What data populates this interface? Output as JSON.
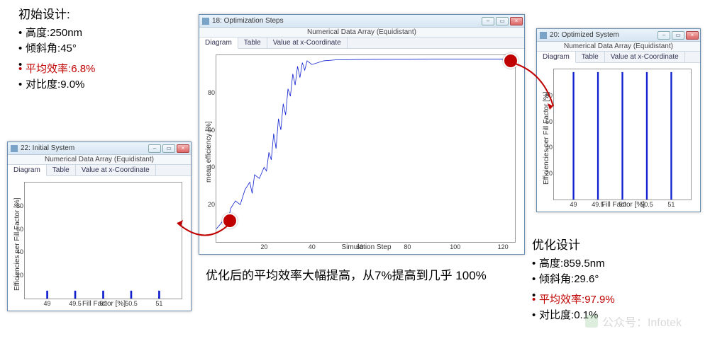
{
  "initial": {
    "heading": "初始设计:",
    "lines": [
      {
        "label": "高度",
        "value": "250nm"
      },
      {
        "label": "倾斜角",
        "value": "45°"
      },
      {
        "label": "平均效率",
        "value": "6.8%",
        "red": true
      },
      {
        "label": "对比度",
        "value": "9.0%"
      }
    ]
  },
  "optimized": {
    "heading": "优化设计",
    "lines": [
      {
        "label": "高度",
        "value": "859.5nm"
      },
      {
        "label": "倾斜角",
        "value": "29.6°"
      },
      {
        "label": "平均效率",
        "value": "97.9%",
        "red": true
      },
      {
        "label": "对比度",
        "value": "0.1%"
      }
    ]
  },
  "caption": "优化后的平均效率大幅提高，从7%提高到几乎 100%",
  "watermark": "公众号：Infotek",
  "windows": {
    "left": {
      "title": "22: Initial System",
      "subtitle": "Numerical Data Array (Equidistant)",
      "tabs": [
        "Diagram",
        "Table",
        "Value at x-Coordinate"
      ],
      "xlabel": "Fill Factor [%]",
      "ylabel": "Efficiencies per Fill Factor [%]"
    },
    "center": {
      "title": "18: Optimization Steps",
      "subtitle": "Numerical Data Array (Equidistant)",
      "tabs": [
        "Diagram",
        "Table",
        "Value at x-Coordinate"
      ],
      "xlabel": "Simulation Step",
      "ylabel": "mean efficiency [%]"
    },
    "right": {
      "title": "20: Optimized System",
      "subtitle": "Numerical Data Array (Equidistant)",
      "tabs": [
        "Diagram",
        "Table",
        "Value at x-Coordinate"
      ],
      "xlabel": "Fill Factor [%]",
      "ylabel": "Efficiencies per Fill Factor [%]"
    }
  },
  "chart_data": [
    {
      "id": "left",
      "type": "bar",
      "xlabel": "Fill Factor [%]",
      "ylabel": "Efficiencies per Fill Factor [%]",
      "categories": [
        49,
        49.5,
        50,
        50.5,
        51
      ],
      "values": [
        6.8,
        6.8,
        6.8,
        6.8,
        6.8
      ],
      "ylim": [
        0,
        100
      ],
      "yticks": [
        20,
        40,
        60,
        80
      ]
    },
    {
      "id": "center",
      "type": "line",
      "xlabel": "Simulation Step",
      "ylabel": "mean efficiency [%]",
      "x": [
        0,
        2,
        4,
        5,
        6,
        8,
        10,
        12,
        14,
        15,
        16,
        18,
        20,
        21,
        22,
        23,
        24,
        25,
        26,
        27,
        28,
        29,
        30,
        31,
        32,
        33,
        34,
        35,
        36,
        37,
        38,
        40,
        45,
        50,
        60,
        70,
        80,
        90,
        100,
        110,
        120
      ],
      "y": [
        7,
        10,
        14,
        12,
        18,
        22,
        20,
        28,
        32,
        26,
        36,
        34,
        40,
        38,
        48,
        44,
        58,
        50,
        66,
        60,
        74,
        68,
        82,
        78,
        90,
        84,
        94,
        88,
        96,
        92,
        97,
        95,
        97,
        97.5,
        97.7,
        97.8,
        97.8,
        97.9,
        97.9,
        97.9,
        97.9
      ],
      "xlim": [
        0,
        125
      ],
      "ylim": [
        0,
        100
      ],
      "xticks": [
        20,
        40,
        60,
        80,
        100,
        120
      ],
      "yticks": [
        20,
        40,
        60,
        80
      ]
    },
    {
      "id": "right",
      "type": "bar",
      "xlabel": "Fill Factor [%]",
      "ylabel": "Efficiencies per Fill Factor [%]",
      "categories": [
        49,
        49.5,
        50,
        50.5,
        51
      ],
      "values": [
        97.9,
        97.9,
        97.9,
        97.9,
        97.9
      ],
      "ylim": [
        0,
        100
      ],
      "yticks": [
        20,
        40,
        60,
        80
      ]
    }
  ]
}
